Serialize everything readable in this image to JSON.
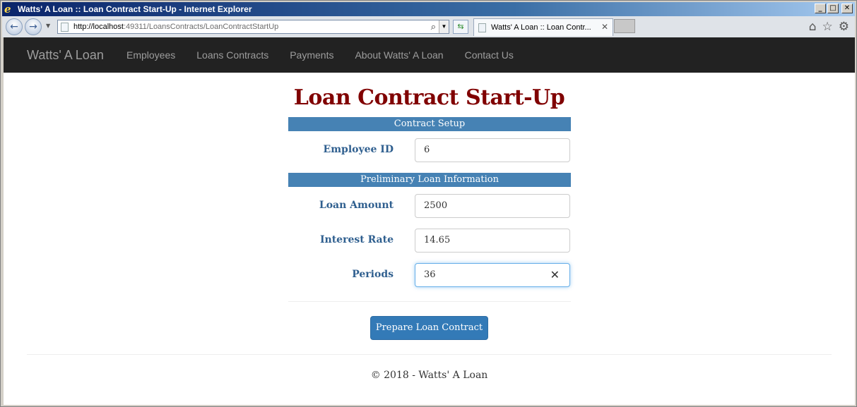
{
  "window": {
    "title": "Watts' A Loan :: Loan Contract Start-Up - Internet Explorer",
    "min_glyph": "0",
    "max_glyph": "1",
    "close_glyph": "r"
  },
  "browser": {
    "url_host": "http://localhost",
    "url_rest": ":49311/LoansContracts/LoanContractStartUp",
    "tab_label": "Watts' A Loan :: Loan Contr...",
    "tab_close": "✕"
  },
  "navbar": {
    "brand": "Watts' A Loan",
    "links": [
      "Employees",
      "Loans Contracts",
      "Payments",
      "About Watts' A Loan",
      "Contact Us"
    ]
  },
  "page": {
    "title": "Loan Contract Start-Up",
    "section_setup": "Contract Setup",
    "section_prelim": "Preliminary Loan Information",
    "fields": {
      "employee_id": {
        "label": "Employee ID",
        "value": "6"
      },
      "loan_amount": {
        "label": "Loan Amount",
        "value": "2500"
      },
      "interest_rate": {
        "label": "Interest Rate",
        "value": "14.65"
      },
      "periods": {
        "label": "Periods",
        "value": "36"
      }
    },
    "clear_glyph": "✕",
    "submit_label": "Prepare Loan Contract",
    "footer": "© 2018 - Watts' A Loan"
  }
}
